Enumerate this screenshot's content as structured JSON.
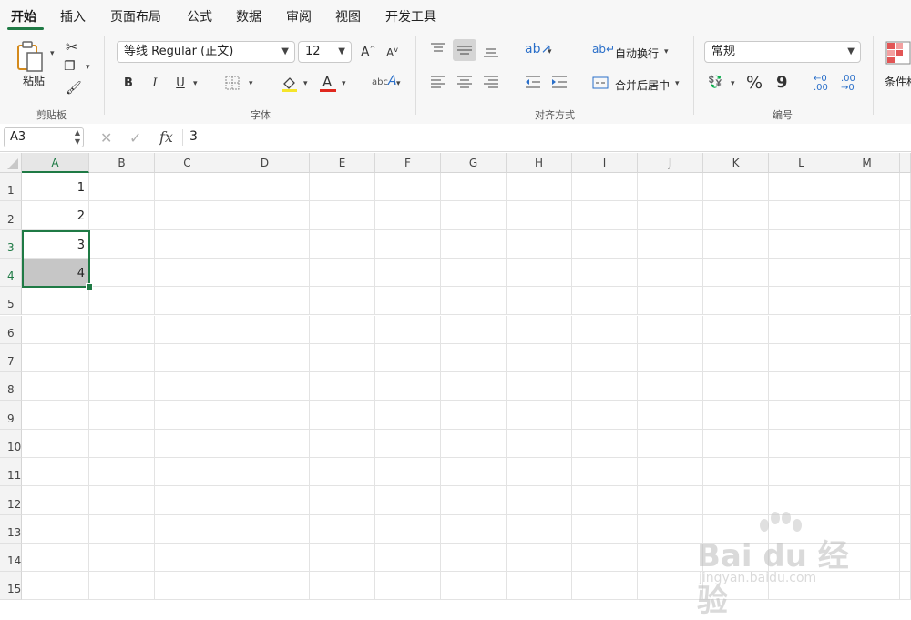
{
  "tabs": [
    "开始",
    "插入",
    "页面布局",
    "公式",
    "数据",
    "审阅",
    "视图",
    "开发工具"
  ],
  "ribbon": {
    "clipboard": {
      "paste_label": "粘贴",
      "group_label": "剪贴板"
    },
    "font": {
      "name": "等线 Regular (正文)",
      "size": "12",
      "group_label": "字体",
      "bold": "B",
      "italic": "I",
      "underline": "U",
      "font_color": "A",
      "highlight_color": "#f5e52b",
      "text_color": "#e0281e"
    },
    "alignment": {
      "wrap_label": "自动换行",
      "merge_label": "合并后居中",
      "group_label": "对齐方式"
    },
    "number": {
      "format": "常规",
      "group_label": "编号",
      "percent": "%",
      "comma": "9"
    },
    "styles": {
      "cond_label": "条件格"
    }
  },
  "formula_bar": {
    "name_box": "A3",
    "fx": "fx",
    "value": "3"
  },
  "columns": [
    "A",
    "B",
    "C",
    "D",
    "E",
    "F",
    "G",
    "H",
    "I",
    "J",
    "K",
    "L",
    "M"
  ],
  "rows": [
    "1",
    "2",
    "3",
    "4",
    "5",
    "6",
    "7",
    "8",
    "9",
    "10",
    "11",
    "12",
    "13",
    "14",
    "15"
  ],
  "cells": {
    "A1": "1",
    "A2": "2",
    "A3": "3",
    "A4": "4"
  },
  "selection": "A3",
  "accent_color": "#1f7a45",
  "watermark": {
    "brand": "Bai du 经验",
    "sub": "jingyan.baidu.com"
  }
}
